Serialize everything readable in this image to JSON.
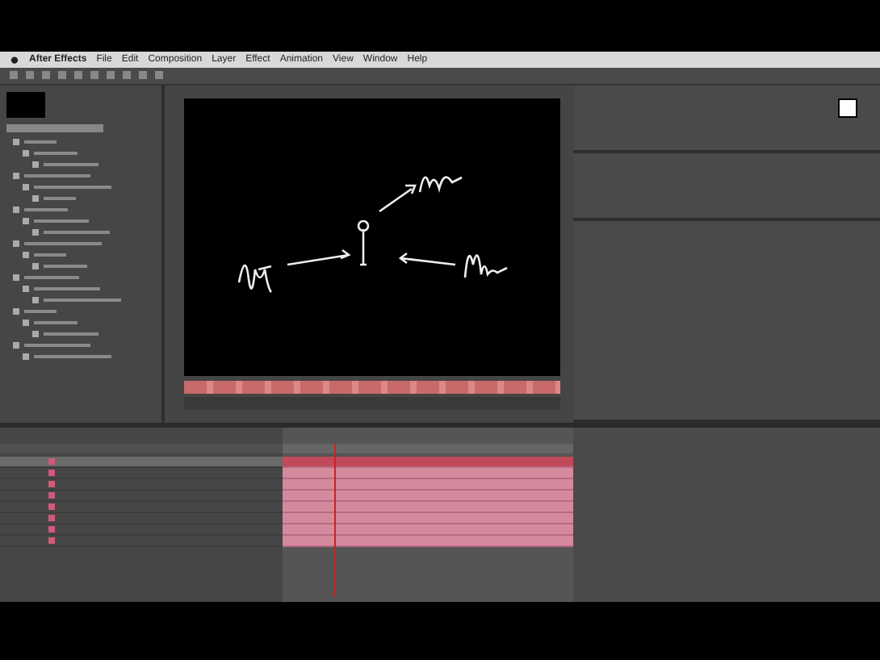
{
  "menu": [
    {
      "label": "After Effects",
      "bold": true
    },
    {
      "label": "File",
      "bold": false
    },
    {
      "label": "Edit",
      "bold": false
    },
    {
      "label": "Composition",
      "bold": false
    },
    {
      "label": "Layer",
      "bold": false
    },
    {
      "label": "Effect",
      "bold": false
    },
    {
      "label": "Animation",
      "bold": false
    },
    {
      "label": "View",
      "bold": false
    },
    {
      "label": "Window",
      "bold": false
    },
    {
      "label": "Help",
      "bold": false
    }
  ],
  "layers": [
    {
      "selected": true
    },
    {
      "selected": false
    },
    {
      "selected": false
    },
    {
      "selected": false
    },
    {
      "selected": false
    },
    {
      "selected": false
    },
    {
      "selected": false
    },
    {
      "selected": false
    }
  ]
}
